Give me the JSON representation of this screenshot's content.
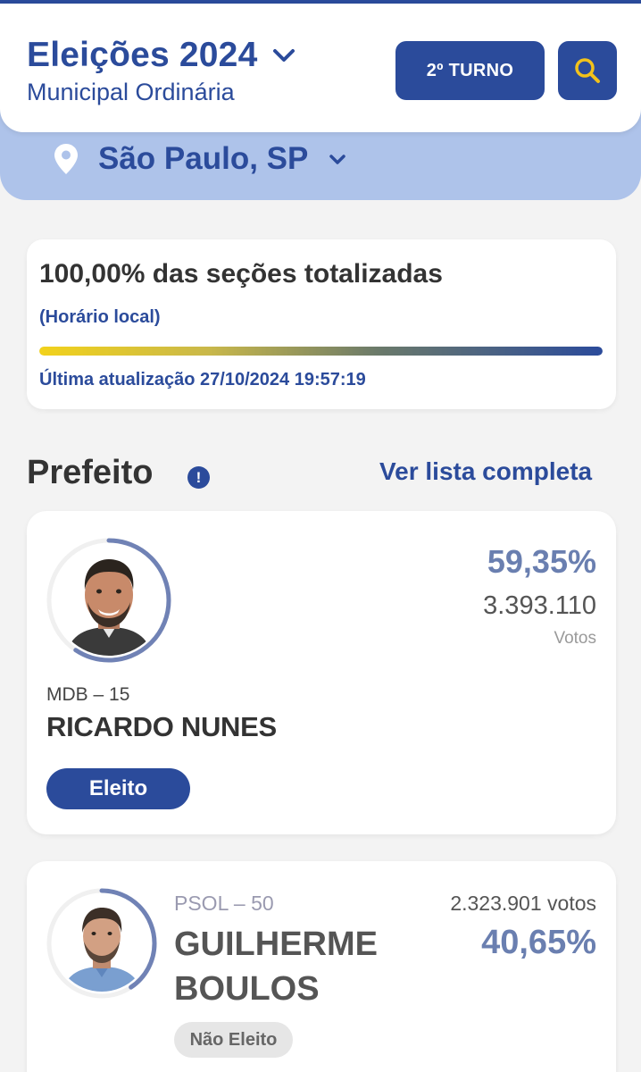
{
  "header": {
    "title": "Eleições 2024",
    "subtitle": "Municipal Ordinária",
    "round_button": "2º TURNO",
    "search_icon": "search-icon",
    "accent_color": "#2b4b9b"
  },
  "location": {
    "name": "São Paulo, SP",
    "icon": "map-pin-icon"
  },
  "status": {
    "title": "100,00% das seções totalizadas",
    "note": "(Horário local)",
    "progress_percent": 100,
    "last_update": "Última atualização 27/10/2024 19:57:19"
  },
  "section": {
    "title": "Prefeito",
    "info_icon": "!",
    "full_list_link": "Ver lista completa"
  },
  "candidates": [
    {
      "party": "MDB – 15",
      "name": "RICARDO NUNES",
      "percent": "59,35%",
      "votes": "3.393.110",
      "votes_label": "Votos",
      "status": "Eleito",
      "ring_fraction": 0.5935
    },
    {
      "party": "PSOL – 50",
      "name": "GUILHERME BOULOS",
      "percent": "40,65%",
      "votes": "2.323.901 votos",
      "status": "Não Eleito",
      "ring_fraction": 0.4065
    }
  ]
}
